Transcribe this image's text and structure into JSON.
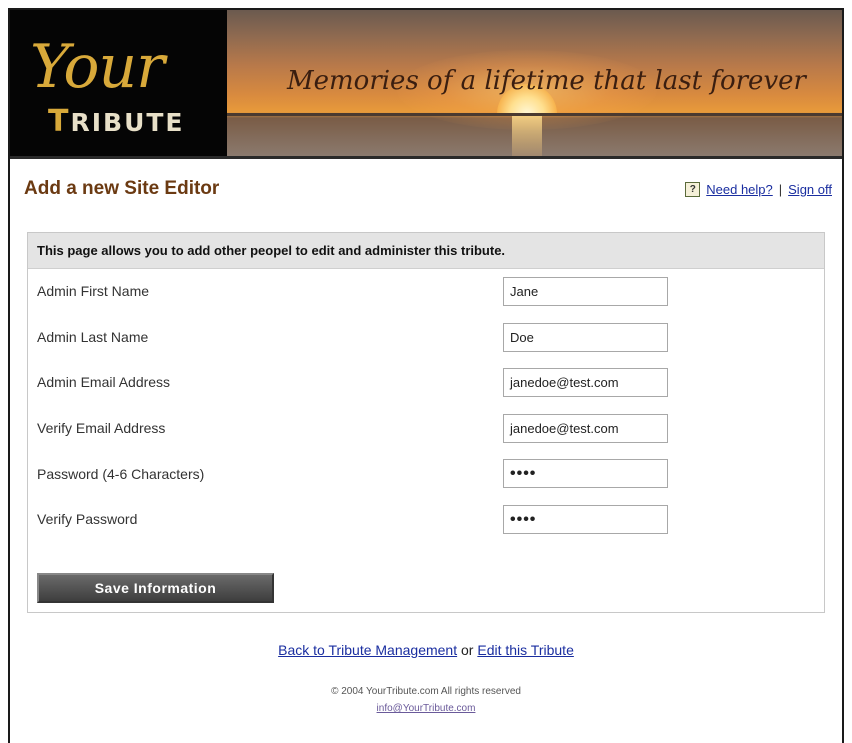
{
  "banner": {
    "logo_line1": "Your",
    "logo_line2": "TRIBUTE",
    "tagline": "Memories of a lifetime that last forever"
  },
  "header": {
    "title": "Add a new Site Editor",
    "help_icon": "?",
    "help_link": "Need help?",
    "separator": "|",
    "signoff_link": "Sign off"
  },
  "form": {
    "intro": "This page allows you to add other peopel to edit and administer this tribute.",
    "fields": [
      {
        "label": "Admin First Name",
        "value": "Jane"
      },
      {
        "label": "Admin Last Name",
        "value": "Doe"
      },
      {
        "label": "Admin Email Address",
        "value": "janedoe@test.com"
      },
      {
        "label": "Verify Email Address",
        "value": "janedoe@test.com"
      },
      {
        "label": "Password (4-6 Characters)",
        "value": "••••"
      },
      {
        "label": "Verify Password",
        "value": "••••"
      }
    ],
    "save_label": "Save Information"
  },
  "footer": {
    "back_link": "Back to Tribute Management",
    "or_text": "or",
    "edit_link": "Edit this Tribute",
    "copyright": "© 2004 YourTribute.com All rights reserved",
    "email": "info@YourTribute.com"
  },
  "colors": {
    "title": "#6b3a12",
    "link": "#1a2ea0",
    "logo_gold": "#d8a93a"
  }
}
